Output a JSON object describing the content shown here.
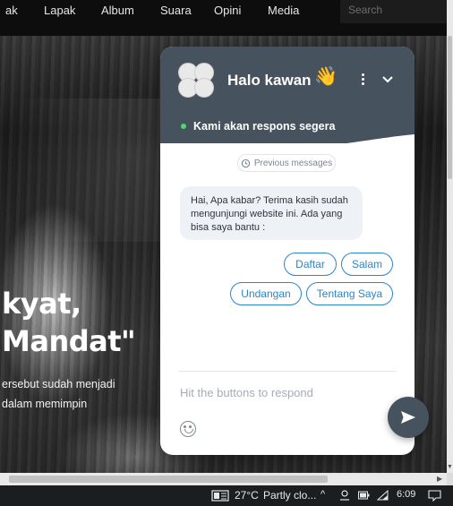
{
  "nav": {
    "items": [
      "ak",
      "Lapak",
      "Album",
      "Suara",
      "Opini",
      "Media"
    ],
    "search_placeholder": "Search"
  },
  "hero": {
    "headline_line1": "kyat,",
    "headline_line2": "Mandat\"",
    "para_line1": "ersebut sudah menjadi",
    "para_line2": "dalam memimpin"
  },
  "chat": {
    "title": "Halo kawan",
    "title_emoji": "👋",
    "status": "Kami akan respons segera",
    "status_color": "#4cd964",
    "header_color": "#46525d",
    "accent_color": "#2a86c9",
    "previous_messages": "Previous messages",
    "bot_message": "Hai, Apa kabar? Terima kasih sudah mengunjungi website ini. Ada yang bisa saya bantu :",
    "buttons": [
      "Daftar",
      "Salam",
      "Undangan",
      "Tentang Saya"
    ],
    "composer_placeholder": "Hit the buttons to respond"
  },
  "taskbar": {
    "temperature": "27°C",
    "weather": "Partly clo...",
    "time": "6:09"
  }
}
